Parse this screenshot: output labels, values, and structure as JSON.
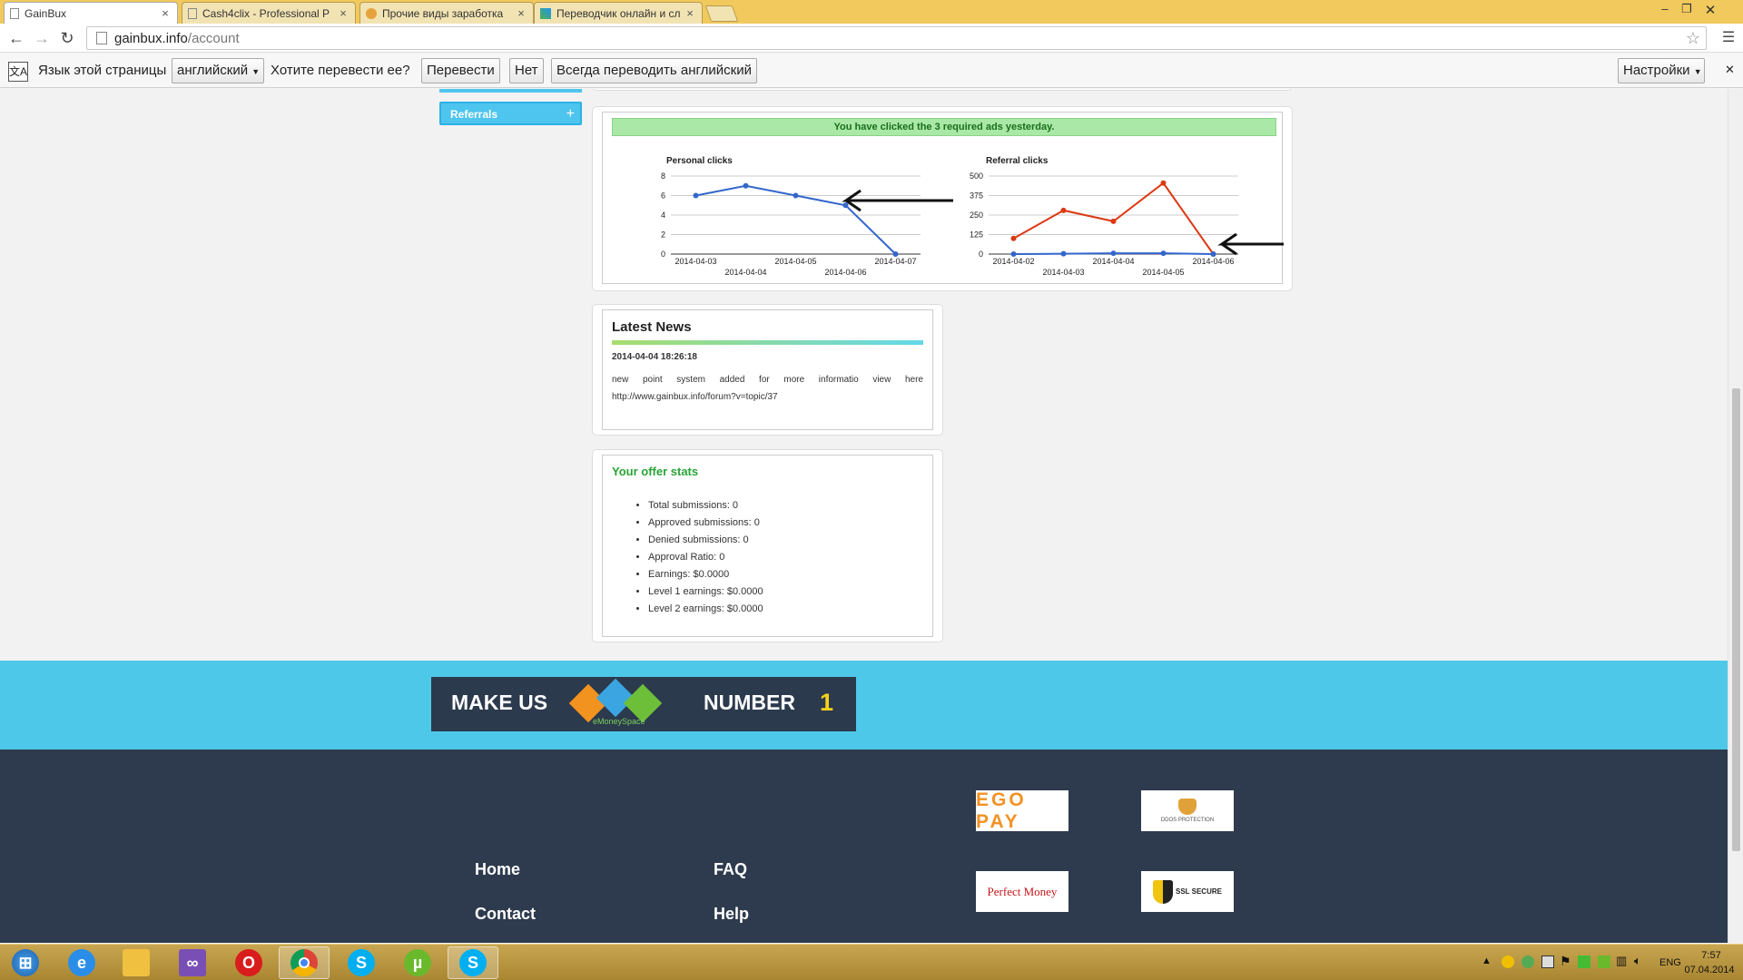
{
  "browser": {
    "tabs": [
      {
        "title": "GainBux",
        "active": true
      },
      {
        "title": "Cash4clix - Professional P",
        "active": false
      },
      {
        "title": "Прочие виды заработка",
        "active": false
      },
      {
        "title": "Переводчик онлайн и сл",
        "active": false
      }
    ],
    "url_host": "gainbux.info",
    "url_path": "/account"
  },
  "translate_bar": {
    "language_label": "Язык этой страницы",
    "language_value": "английский",
    "question": "Хотите перевести ее?",
    "translate_button": "Перевести",
    "no_button": "Нет",
    "always_button": "Всегда переводить английский",
    "settings_button": "Настройки"
  },
  "sidebar": {
    "referrals_label": "Referrals"
  },
  "clicks_card": {
    "notice": "You have clicked the 3 required ads yesterday."
  },
  "chart_data": [
    {
      "type": "line",
      "title": "Personal clicks",
      "x": [
        "2014-04-03",
        "2014-04-04",
        "2014-04-05",
        "2014-04-06",
        "2014-04-07"
      ],
      "series": [
        {
          "values": [
            6,
            7,
            6,
            5,
            0
          ],
          "color": "#3366cc"
        }
      ],
      "yticks": [
        0,
        2,
        4,
        6,
        8
      ],
      "ylim": [
        0,
        8
      ],
      "grid": true,
      "legend": "none"
    },
    {
      "type": "line",
      "title": "Referral clicks",
      "x": [
        "2014-04-02",
        "2014-04-03",
        "2014-04-04",
        "2014-04-05",
        "2014-04-06"
      ],
      "series": [
        {
          "values": [
            100,
            280,
            210,
            455,
            0
          ],
          "color": "#dc3912"
        },
        {
          "values": [
            0,
            2,
            5,
            5,
            0
          ],
          "color": "#3366cc"
        }
      ],
      "yticks": [
        0,
        125,
        250,
        375,
        500
      ],
      "ylim": [
        0,
        500
      ],
      "grid": true,
      "legend": "none"
    }
  ],
  "news": {
    "title": "Latest News",
    "date": "2014-04-04 18:26:18",
    "body": "new point system added for more informatio view here http://www.gainbux.info/forum?v=topic/37"
  },
  "offers": {
    "title": "Your offer stats",
    "items": [
      "Total submissions: 0",
      "Approved submissions: 0",
      "Denied submissions: 0",
      "Approval Ratio: 0",
      "Earnings: $0.0000",
      "Level 1 earnings: $0.0000",
      "Level 2 earnings: $0.0000"
    ]
  },
  "banner": {
    "left": "MAKE US",
    "right": "NUMBER",
    "number": "1",
    "logo_caption": "eMoneySpace"
  },
  "footer": {
    "links": [
      "Home",
      "FAQ",
      "Contact",
      "Help"
    ],
    "badges": [
      "EGO PAY",
      "DDOS PROTECTION",
      "Perfect Money",
      "SSL SECURE"
    ]
  },
  "taskbar": {
    "lang": "ENG",
    "time": "7:57",
    "date": "07.04.2014"
  },
  "colors": {
    "accent": "#4ec8e8",
    "footer": "#2e3b4e",
    "news_green": "#28a436"
  }
}
